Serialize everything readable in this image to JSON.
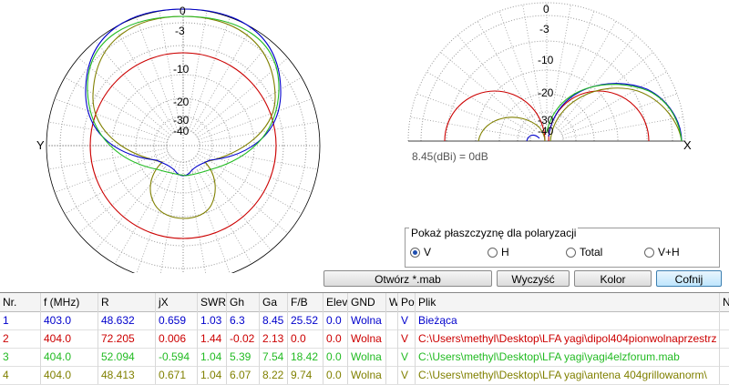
{
  "left_plot": {
    "axis_y_label": "Y",
    "rings": [
      "0",
      "-3",
      "-10",
      "-20",
      "-30",
      "-40"
    ]
  },
  "right_plot": {
    "axis_x_label": "X",
    "rings": [
      "0",
      "-3",
      "-10",
      "-20",
      "-30",
      "-40"
    ]
  },
  "scale_note": "8.45(dBi) = 0dB",
  "polarization": {
    "title": "Pokaż płaszczyznę dla polaryzacji",
    "options": [
      {
        "label": "V",
        "selected": true
      },
      {
        "label": "H",
        "selected": false
      },
      {
        "label": "Total",
        "selected": false
      },
      {
        "label": "V+H",
        "selected": false
      }
    ]
  },
  "buttons": {
    "open": "Otwórz *.mab",
    "clear": "Wyczyść",
    "color": "Kolor",
    "undo": "Cofnij"
  },
  "colors": {
    "series1": "#0000cc",
    "series2": "#cc0000",
    "series3": "#22bb22",
    "series4": "#808000"
  },
  "table": {
    "headers": [
      "Nr.",
      "f (MHz)",
      "R",
      "jX",
      "SWR",
      "Gh",
      "Ga",
      "F/B",
      "Elev",
      "GND",
      "W",
      "Po",
      "Plik",
      "N"
    ],
    "rows": [
      [
        "1",
        "403.0",
        "48.632",
        "0.659",
        "1.03",
        "6.3",
        "8.45",
        "25.52",
        "0.0",
        "Wolna",
        "",
        "V",
        "Bieżąca"
      ],
      [
        "2",
        "404.0",
        "72.205",
        "0.006",
        "1.44",
        "-0.02",
        "2.13",
        "0.0",
        "0.0",
        "Wolna",
        "",
        "V",
        "C:\\Users\\methyl\\Desktop\\LFA yagi\\dipol404pionwolnaprzestrz"
      ],
      [
        "3",
        "404.0",
        "52.094",
        "-0.594",
        "1.04",
        "5.39",
        "7.54",
        "18.42",
        "0.0",
        "Wolna",
        "",
        "V",
        "C:\\Users\\methyl\\Desktop\\LFA yagi\\yagi4elzforum.mab"
      ],
      [
        "4",
        "404.0",
        "48.413",
        "0.671",
        "1.04",
        "6.07",
        "8.22",
        "9.74",
        "0.0",
        "Wolna",
        "",
        "V",
        "C:\\Users\\methyl\\Desktop\\LFA yagi\\antena 404grillowanorm\\"
      ]
    ]
  }
}
